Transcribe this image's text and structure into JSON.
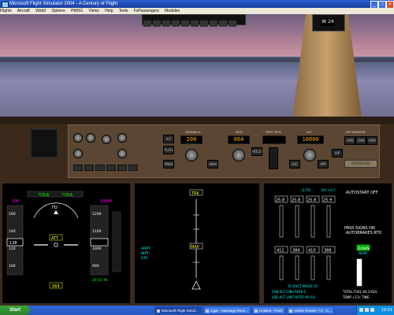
{
  "window": {
    "title": "Microsoft Flight Simulator 2004 - A Century of Flight",
    "min_glyph": "_",
    "max_glyph": "□",
    "close_glyph": "×"
  },
  "menubar": {
    "items": [
      "Flights",
      "Aircraft",
      "World",
      "Options",
      "PMDG",
      "Views",
      "Help",
      "Tools",
      "FsPassengers",
      "Modules"
    ]
  },
  "compass": {
    "value": "W 24"
  },
  "mcp": {
    "ias_label": "IAS/MACH",
    "ias_value": "200",
    "hdg_label": "HDG",
    "hdg_value": "064",
    "vs_label": "VERT SPD",
    "vs_value": "",
    "alt_label": "ALT",
    "alt_value": "10000",
    "ap_engage_label": "A/P ENGAGE",
    "disengage_label": "DISENGAGE",
    "buttons": [
      "A/T",
      "FLCH",
      "VNAV",
      "LNAV",
      "HOLD",
      "LOC",
      "APP",
      "A/P",
      "CMD",
      "CMD",
      "CMD"
    ]
  },
  "pfd": {
    "mode_1": "TOGA",
    "mode_2": "TOGA",
    "fd_label": "FD",
    "att_label": "ATT",
    "ias_top": "200",
    "ias_cur": "138",
    "alt_top": "10000",
    "alt_cur": "",
    "baro": "29.92 IN",
    "hdg_box": "064",
    "speed_tape": [
      "160",
      "140",
      "120",
      "100"
    ],
    "alt_tape": [
      "1200",
      "1100",
      "1000",
      "900"
    ]
  },
  "nd": {
    "trk_label": "TRK",
    "map_label": "MAP",
    "left_legend": [
      "ARPT",
      "WPT",
      "STA"
    ]
  },
  "eicas": {
    "header_left": "G-TO",
    "header_right": "101 +4 C",
    "autostart": "AUTOSTART OFF",
    "epr_values": [
      "25.8",
      "25.8",
      "25.8",
      "25.9"
    ],
    "n1_values": [
      "411",
      "384",
      "410",
      "388"
    ],
    "msg_1": "PASS SIGNS ON",
    "msg_2": "AUTOBRAKES RTO",
    "gear_label": "DOWN",
    "gear_sub": "GEAR",
    "duct_press": "35 DUCT PRESS 35",
    "cab_alt": "CAB ALT  1380  RATE  0",
    "ldg_alt": "LDG ALT  1467  AUTO  AP  0.0",
    "total_fuel": "TOTAL FUEL  94.3 KGS",
    "temp": "TEMP  +17c  TIME"
  },
  "taskbar": {
    "start": "Start",
    "tasks": [
      "Microsoft Flight Simul...",
      "Ligar - Message Rece...",
      "Untitled - Paint",
      "Adobe Reader 7.0 - C..."
    ],
    "clock": "19:51"
  }
}
